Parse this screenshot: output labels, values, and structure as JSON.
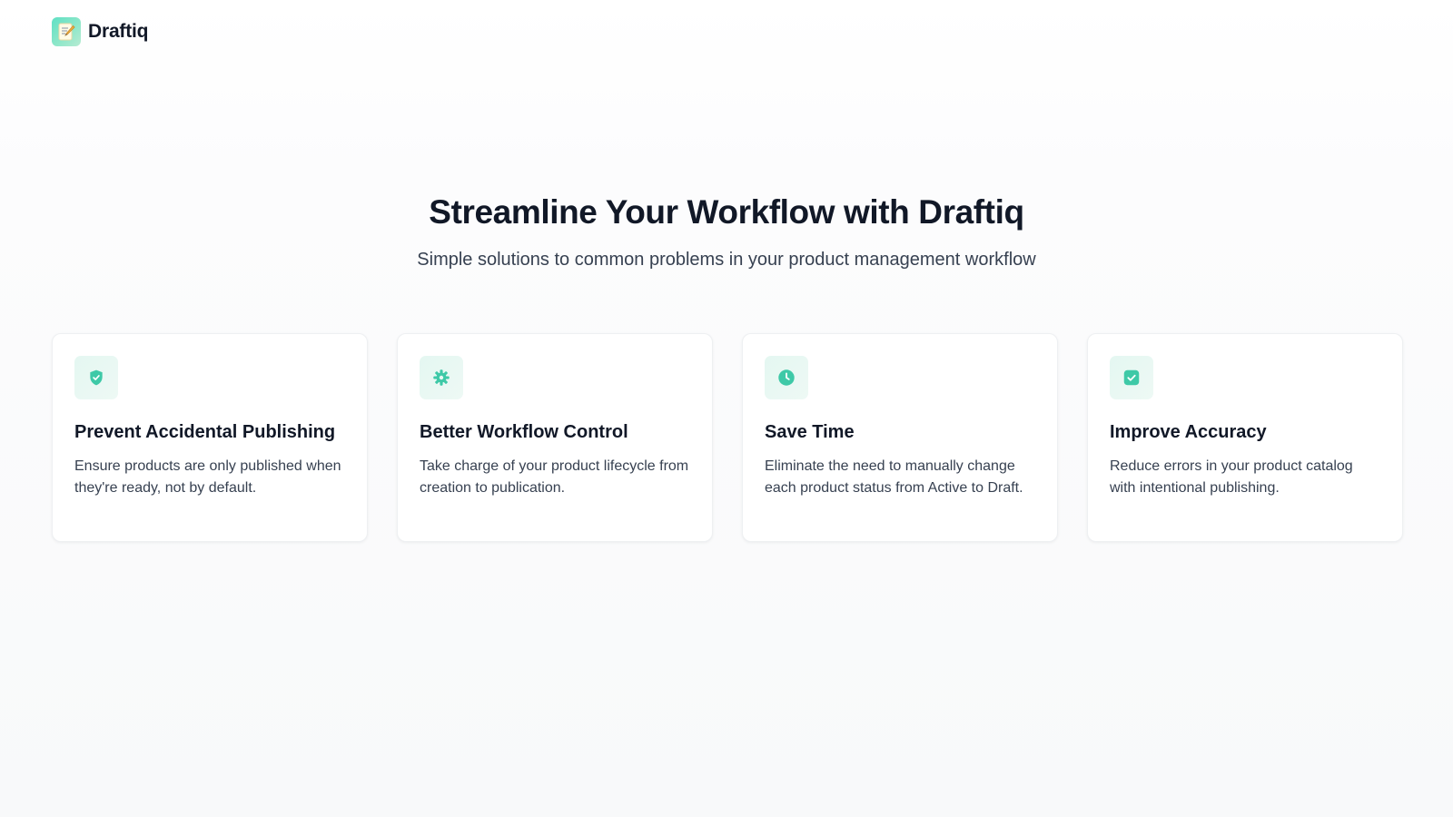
{
  "brand": {
    "name": "Draftiq",
    "logo_icon": "memo-pencil-icon"
  },
  "hero": {
    "title": "Streamline Your Workflow with Draftiq",
    "subtitle": "Simple solutions to common problems in your product management workflow"
  },
  "features": [
    {
      "icon": "shield-check-icon",
      "title": "Prevent Accidental Publishing",
      "description": "Ensure products are only published when they're ready, not by default."
    },
    {
      "icon": "gear-icon",
      "title": "Better Workflow Control",
      "description": "Take charge of your product lifecycle from creation to publication."
    },
    {
      "icon": "clock-icon",
      "title": "Save Time",
      "description": "Eliminate the need to manually change each product status from Active to Draft."
    },
    {
      "icon": "check-square-icon",
      "title": "Improve Accuracy",
      "description": "Reduce errors in your product catalog with intentional publishing."
    }
  ],
  "colors": {
    "accent": "#3ec9a7",
    "accent_light": "#e4f7f1",
    "heading": "#111827",
    "body_text": "#374151"
  }
}
